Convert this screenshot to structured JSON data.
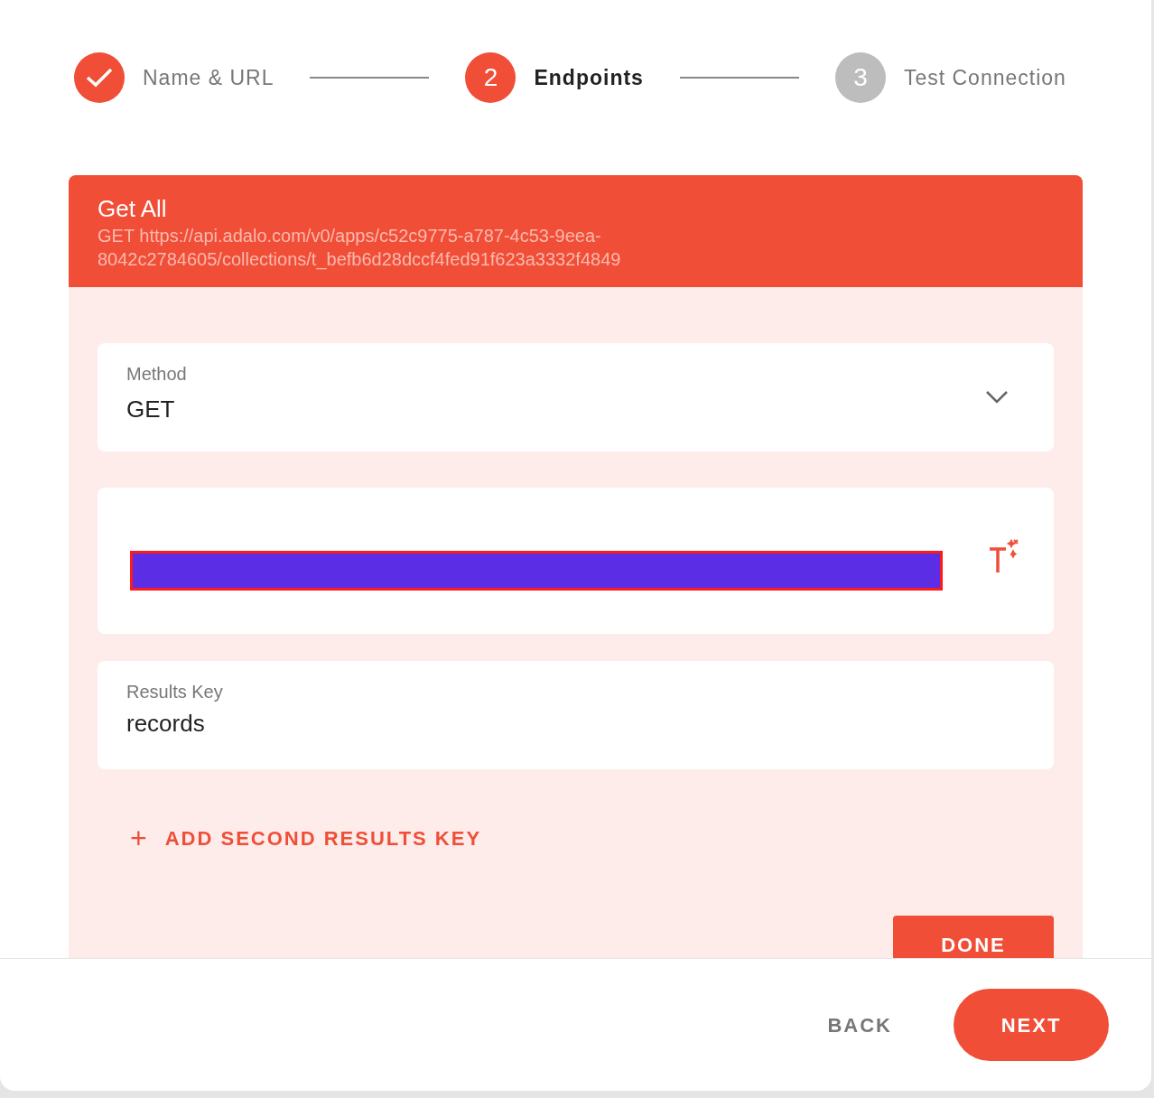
{
  "steps": [
    {
      "label": "Name & URL",
      "kind": "done"
    },
    {
      "label": "Endpoints",
      "number": "2",
      "kind": "current"
    },
    {
      "label": "Test Connection",
      "number": "3",
      "kind": "upcoming"
    }
  ],
  "endpoint": {
    "title": "Get All",
    "subtitle": "GET https://api.adalo.com/v0/apps/c52c9775-a787-4c53-9eea-8042c2784605/collections/t_befb6d28dccf4fed91f623a3332f4849",
    "method": {
      "label": "Method",
      "value": "GET"
    },
    "url": {
      "redacted": true
    },
    "results_key": {
      "label": "Results Key",
      "value": "records"
    },
    "add_link": {
      "icon": "+",
      "label": "ADD SECOND RESULTS KEY"
    },
    "done_button": "DONE"
  },
  "footer": {
    "back": "BACK",
    "next": "NEXT"
  }
}
